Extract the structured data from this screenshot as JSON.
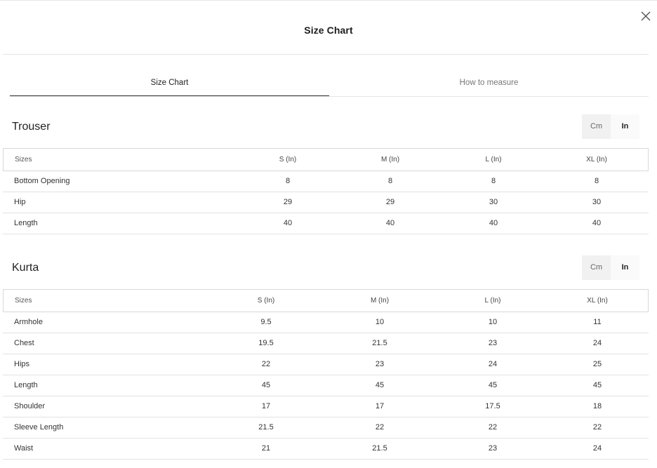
{
  "modal": {
    "title": "Size Chart"
  },
  "tabs": [
    {
      "label": "Size Chart",
      "active": true
    },
    {
      "label": "How to measure",
      "active": false
    }
  ],
  "units": {
    "cm": "Cm",
    "in": "In",
    "selected": "In"
  },
  "sections": [
    {
      "title": "Trouser",
      "headers": [
        "Sizes",
        "S (In)",
        "M (In)",
        "L (In)",
        "XL (In)"
      ],
      "rows": [
        [
          "Bottom Opening",
          "8",
          "8",
          "8",
          "8"
        ],
        [
          "Hip",
          "29",
          "29",
          "30",
          "30"
        ],
        [
          "Length",
          "40",
          "40",
          "40",
          "40"
        ]
      ]
    },
    {
      "title": "Kurta",
      "headers": [
        "Sizes",
        "S (In)",
        "M (In)",
        "L (In)",
        "XL (In)"
      ],
      "rows": [
        [
          "Armhole",
          "9.5",
          "10",
          "10",
          "11"
        ],
        [
          "Chest",
          "19.5",
          "21.5",
          "23",
          "24"
        ],
        [
          "Hips",
          "22",
          "23",
          "24",
          "25"
        ],
        [
          "Length",
          "45",
          "45",
          "45",
          "45"
        ],
        [
          "Shoulder",
          "17",
          "17",
          "17.5",
          "18"
        ],
        [
          "Sleeve Length",
          "21.5",
          "22",
          "22",
          "22"
        ],
        [
          "Waist",
          "21",
          "21.5",
          "23",
          "24"
        ]
      ]
    }
  ],
  "icons": {
    "close": "close-icon"
  }
}
